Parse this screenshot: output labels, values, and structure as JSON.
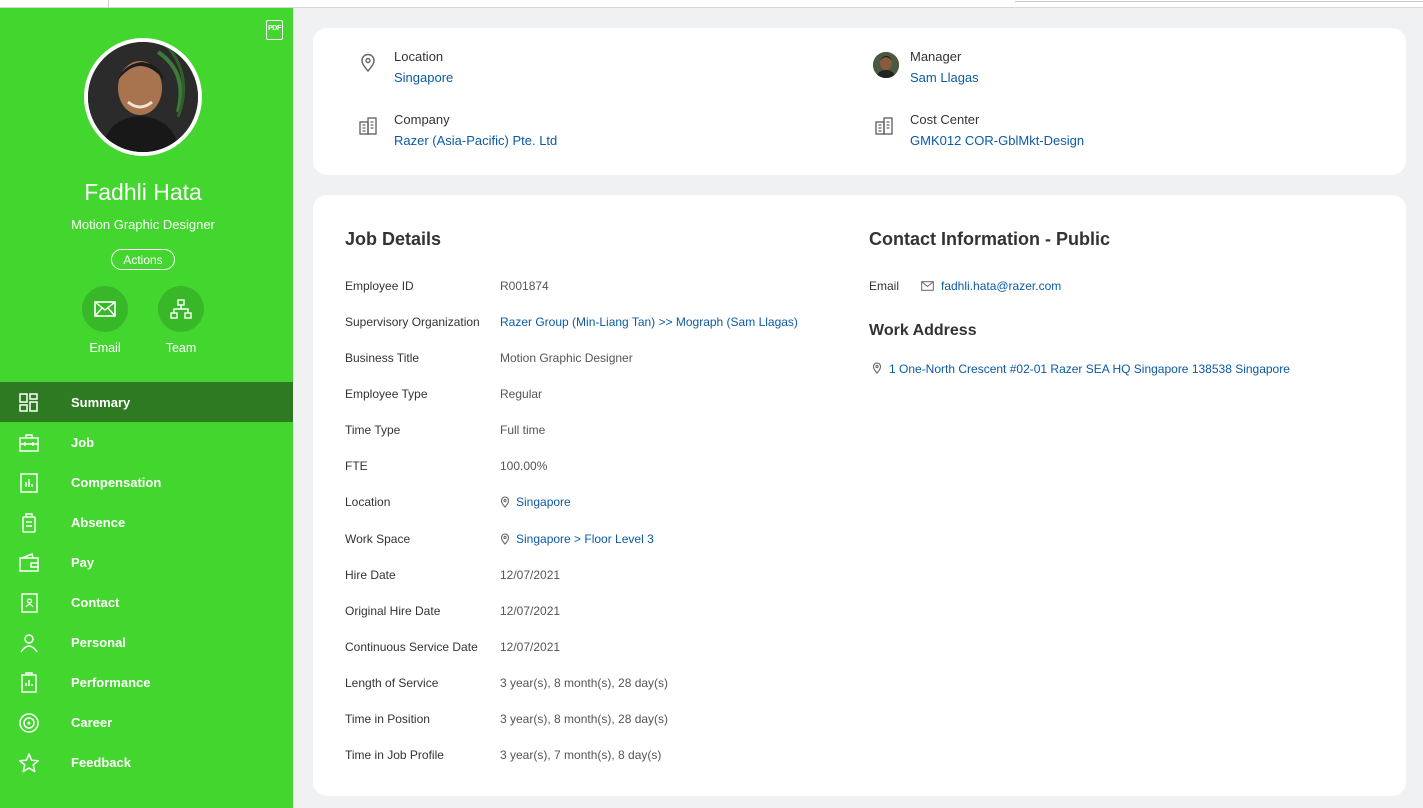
{
  "profile": {
    "name": "Fadhli Hata",
    "title": "Motion Graphic Designer",
    "pdf_label": "PDF",
    "actions_label": "Actions",
    "email_label": "Email",
    "team_label": "Team"
  },
  "nav": [
    {
      "label": "Summary",
      "icon": "dashboard-icon",
      "active": true
    },
    {
      "label": "Job",
      "icon": "briefcase-icon"
    },
    {
      "label": "Compensation",
      "icon": "chart-icon"
    },
    {
      "label": "Absence",
      "icon": "luggage-icon"
    },
    {
      "label": "Pay",
      "icon": "wallet-icon"
    },
    {
      "label": "Contact",
      "icon": "contact-book-icon"
    },
    {
      "label": "Personal",
      "icon": "person-icon"
    },
    {
      "label": "Performance",
      "icon": "clipboard-icon"
    },
    {
      "label": "Career",
      "icon": "target-icon"
    },
    {
      "label": "Feedback",
      "icon": "star-icon"
    }
  ],
  "summary": {
    "location_label": "Location",
    "location_value": "Singapore",
    "manager_label": "Manager",
    "manager_value": "Sam Llagas",
    "company_label": "Company",
    "company_value": "Razer (Asia-Pacific) Pte. Ltd",
    "cost_center_label": "Cost Center",
    "cost_center_value": "GMK012 COR-GblMkt-Design"
  },
  "job_details": {
    "title": "Job Details",
    "rows": [
      {
        "label": "Employee ID",
        "value": "R001874"
      },
      {
        "label": "Supervisory Organization",
        "value": "Razer Group (Min-Liang Tan) >> Mograph (Sam Llagas)"
      },
      {
        "label": "Business Title",
        "value": "Motion Graphic Designer"
      },
      {
        "label": "Employee Type",
        "value": "Regular"
      },
      {
        "label": "Time Type",
        "value": "Full time"
      },
      {
        "label": "FTE",
        "value": "100.00%"
      },
      {
        "label": "Location",
        "value": "Singapore"
      },
      {
        "label": "Work Space",
        "value": "Singapore > Floor Level 3"
      },
      {
        "label": "Hire Date",
        "value": "12/07/2021"
      },
      {
        "label": "Original Hire Date",
        "value": "12/07/2021"
      },
      {
        "label": "Continuous Service Date",
        "value": "12/07/2021"
      },
      {
        "label": "Length of Service",
        "value": "3 year(s), 8 month(s), 28 day(s)"
      },
      {
        "label": "Time in Position",
        "value": "3 year(s), 8 month(s), 28 day(s)"
      },
      {
        "label": "Time in Job Profile",
        "value": "3 year(s), 7 month(s), 8 day(s)"
      }
    ]
  },
  "contact": {
    "title": "Contact Information - Public",
    "email_label": "Email",
    "email_value": "fadhli.hata@razer.com",
    "work_address_title": "Work Address",
    "work_address_value": "1 One-North Crescent #02-01 Razer SEA HQ Singapore 138538 Singapore"
  },
  "colors": {
    "sidebar": "#43d62f",
    "sidebar_active": "#2e7a23",
    "link": "#0b5aa6"
  }
}
